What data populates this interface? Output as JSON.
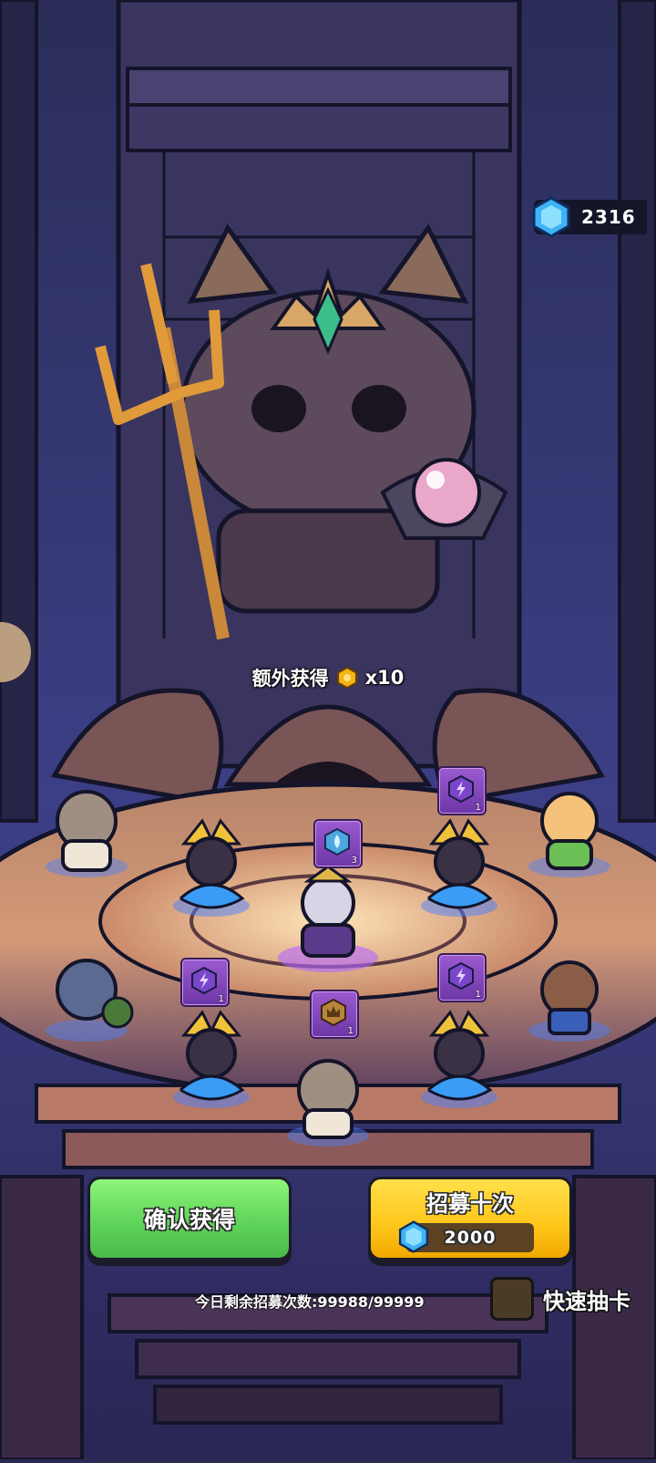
{
  "currency": {
    "amount": "2316",
    "icon": "blue-gem-icon"
  },
  "bonus": {
    "label": "额外获得",
    "reward_icon": "gold-coin-icon",
    "quantity": "x10"
  },
  "items": [
    {
      "icon": "water-drop-icon",
      "count": "3"
    },
    {
      "icon": "lightning-icon",
      "count": "1"
    },
    {
      "icon": "lightning-icon",
      "count": "1"
    },
    {
      "icon": "lightning-icon",
      "count": "1"
    },
    {
      "icon": "crown-icon",
      "count": "1"
    }
  ],
  "buttons": {
    "confirm_label": "确认获得",
    "recruit_label": "招募十次",
    "recruit_cost": "2000"
  },
  "remaining": {
    "text": "今日剩余招募次数:99988/99999"
  },
  "quick_draw": {
    "label": "快速抽卡",
    "checked": false
  },
  "colors": {
    "confirm": "#5fd45a",
    "recruit": "#ffc61a",
    "gem": "#3fb3f5",
    "item_card": "#8a4ac4"
  }
}
